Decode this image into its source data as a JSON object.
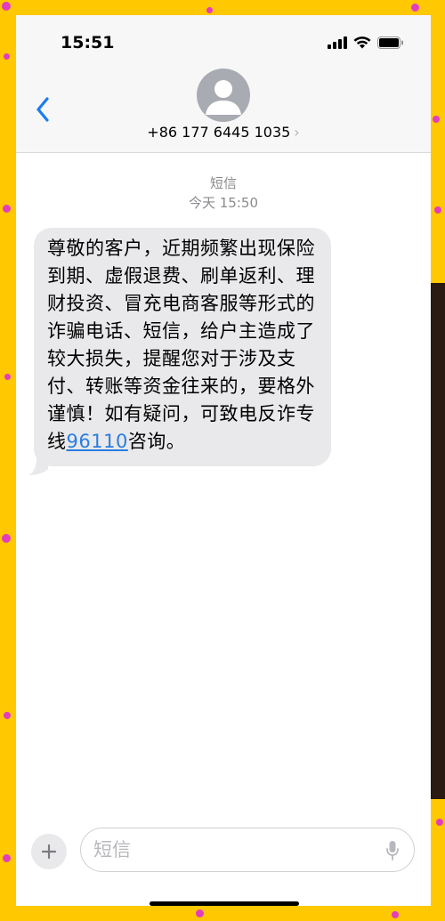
{
  "status_bar": {
    "time": "15:51"
  },
  "header": {
    "contact": "+86 177 6445 1035",
    "chevron": "›"
  },
  "conversation": {
    "label": "短信",
    "timestamp": "今天 15:50"
  },
  "message": {
    "text_before_link": "尊敬的客户，近期频繁出现保险到期、虚假退费、刷单返利、理财投资、冒充电商客服等形式的诈骗电话、短信，给户主造成了较大损失，提醒您对于涉及支付、转账等资金往来的，要格外谨慎！如有疑问，可致电反诈专线",
    "link": "96110",
    "text_after_link": "咨询。"
  },
  "composer": {
    "placeholder": "短信",
    "plus": "+"
  },
  "colors": {
    "background": "#ffc800",
    "confetti": "#e33dbf",
    "link": "#2a7de1",
    "bubble": "#e9e9eb",
    "back_arrow": "#1a7cf0"
  },
  "icons": [
    "back-arrow-icon",
    "person-icon",
    "signal-icon",
    "wifi-icon",
    "battery-icon",
    "plus-icon",
    "mic-icon"
  ]
}
